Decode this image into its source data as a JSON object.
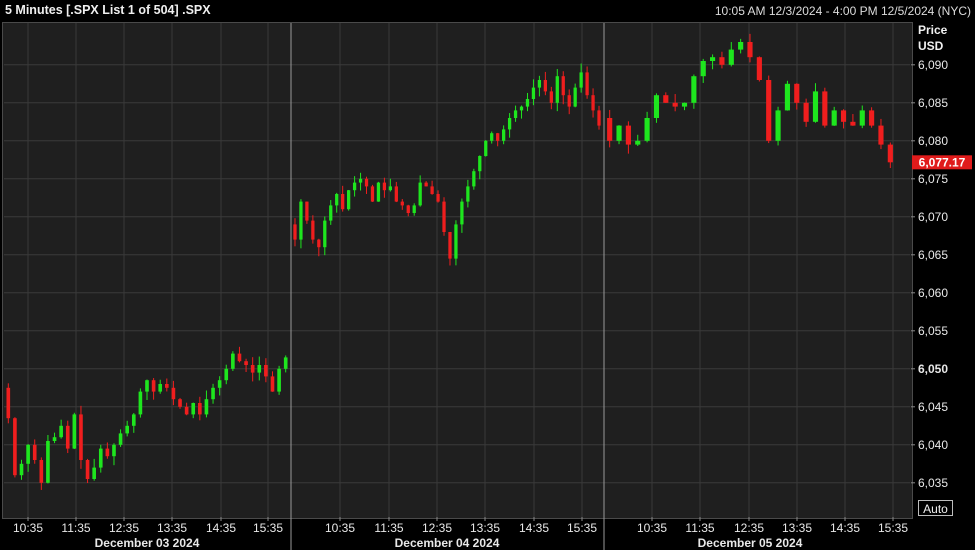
{
  "header": {
    "title": "5 Minutes [.SPX List 1 of 504] .SPX",
    "range": "10:05 AM 12/3/2024 - 4:00 PM 12/5/2024 (NYC)"
  },
  "axis": {
    "unit_line1": "Price",
    "unit_line2": "USD",
    "auto_label": "Auto"
  },
  "colors": {
    "up": "#1ee61e",
    "down": "#f01e1e",
    "grid": "#3a3a3a",
    "last_price_bg": "#e01b1b"
  },
  "chart_data": {
    "type": "candlestick",
    "y_ticks": [
      6035,
      6040,
      6045,
      6050,
      6055,
      6060,
      6065,
      6070,
      6075,
      6080,
      6085,
      6090
    ],
    "y_tick_labels": [
      "6,035",
      "6,040",
      "6,045",
      "6,050",
      "6,055",
      "6,060",
      "6,065",
      "6,070",
      "6,075",
      "6,080",
      "6,085",
      "6,090"
    ],
    "y_range": [
      6030.5,
      6095.5
    ],
    "last_price": 6077.17,
    "last_price_label": "6,077.17",
    "days": [
      {
        "date_label": "December 03 2024",
        "time_ticks": [
          "10:35",
          "11:35",
          "12:35",
          "13:35",
          "14:35",
          "15:35"
        ],
        "path": [
          6047.5,
          6043.5,
          6036.0,
          6037.5,
          6040.0,
          6038.0,
          6035.0,
          6040.5,
          6041.0,
          6042.5,
          6039.5,
          6044.0,
          6038.0,
          6035.5,
          6037.0,
          6039.5,
          6038.5,
          6040.0,
          6041.5,
          6042.5,
          6044.0,
          6047.0,
          6048.5,
          6047.0,
          6048.0,
          6047.5,
          6046.0,
          6045.0,
          6044.0,
          6045.5,
          6044.0,
          6046.0,
          6047.5,
          6048.5,
          6050.0,
          6052.0,
          6051.0,
          6050.5,
          6049.5,
          6050.5,
          6049.0,
          6047.0,
          6050.0,
          6051.5
        ]
      },
      {
        "date_label": "December 04 2024",
        "time_ticks": [
          "10:35",
          "11:35",
          "12:35",
          "13:35",
          "14:35",
          "15:35"
        ],
        "path": [
          6069.0,
          6067.0,
          6072.0,
          6069.5,
          6067.0,
          6066.0,
          6069.5,
          6071.5,
          6073.0,
          6071.0,
          6073.5,
          6074.5,
          6075.0,
          6074.0,
          6072.0,
          6074.5,
          6073.5,
          6074.0,
          6072.0,
          6071.5,
          6070.5,
          6071.5,
          6074.5,
          6074.0,
          6073.0,
          6072.0,
          6068.0,
          6064.5,
          6069.0,
          6072.0,
          6074.0,
          6076.0,
          6078.0,
          6080.0,
          6081.0,
          6080.0,
          6081.5,
          6083.0,
          6084.0,
          6084.5,
          6085.5,
          6087.0,
          6088.0,
          6086.5,
          6085.0,
          6088.5,
          6086.0,
          6084.5,
          6087.0,
          6089.0,
          6086.0,
          6084.0,
          6082.0
        ]
      },
      {
        "date_label": "December 05 2024",
        "time_ticks": [
          "10:35",
          "11:35",
          "12:35",
          "13:35",
          "14:35",
          "15:35"
        ],
        "path": [
          6083.0,
          6080.0,
          6082.0,
          6079.5,
          6080.0,
          6083.0,
          6086.0,
          6085.0,
          6084.5,
          6085.0,
          6088.5,
          6090.5,
          6091.0,
          6090.0,
          6092.0,
          6093.0,
          6091.0,
          6088.0,
          6080.0,
          6084.0,
          6087.5,
          6085.0,
          6082.5,
          6086.5,
          6082.0,
          6084.0,
          6082.5,
          6082.0,
          6084.0,
          6082.0,
          6079.5,
          6077.17
        ]
      }
    ],
    "day_boundaries_px": []
  }
}
